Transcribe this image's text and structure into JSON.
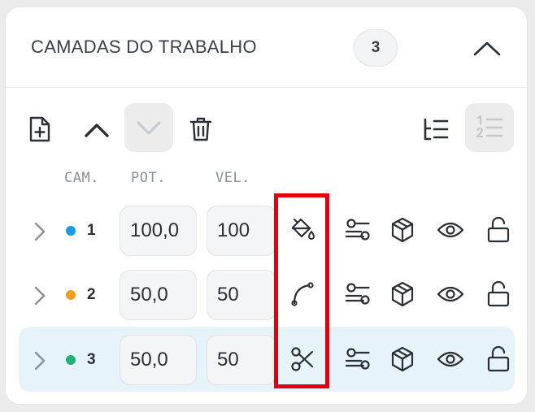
{
  "panel": {
    "title": "CAMADAS DO TRABALHO",
    "layer_count": "3"
  },
  "toolbar": {
    "icons": [
      "add-file-icon",
      "move-up-icon",
      "move-down-icon",
      "delete-icon",
      "list-view-icon",
      "numbered-list-icon"
    ],
    "move_down_disabled": true,
    "numbered_list_active": true
  },
  "columns": {
    "cam": "CAM.",
    "pot": "POT.",
    "vel": "VEL."
  },
  "layers": [
    {
      "number": "1",
      "color": "#1a9be6",
      "power": "100,0",
      "speed": "100",
      "mode_icon": "fill-bucket-icon",
      "selected": false
    },
    {
      "number": "2",
      "color": "#f29b1d",
      "power": "50,0",
      "speed": "50",
      "mode_icon": "curve-line-icon",
      "selected": false
    },
    {
      "number": "3",
      "color": "#1db37a",
      "power": "50,0",
      "speed": "50",
      "mode_icon": "scissors-icon",
      "selected": true
    }
  ],
  "row_actions": [
    "settings-sliders-icon",
    "cube-icon",
    "eye-icon",
    "unlock-icon"
  ],
  "colors": {
    "selected_row": "#e6f3f8",
    "highlight": "#e1000f"
  }
}
